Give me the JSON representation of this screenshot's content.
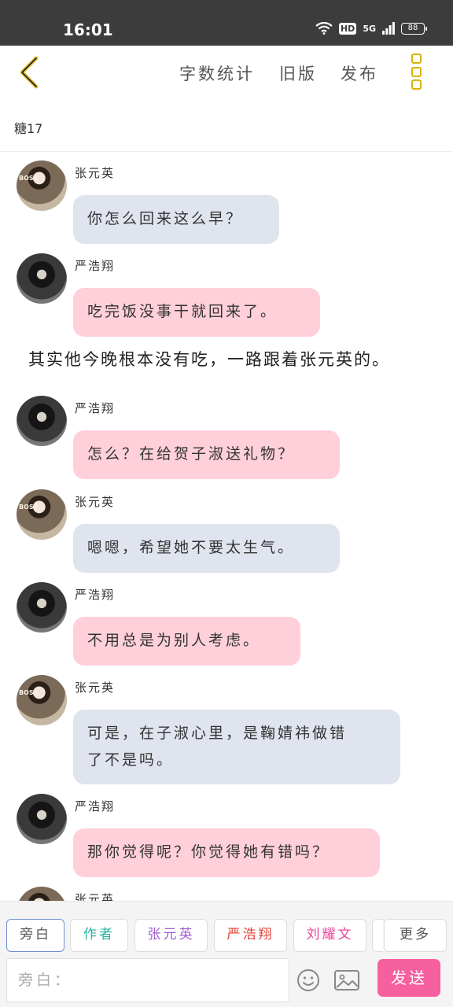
{
  "status": {
    "time": "16:01",
    "hd": "HD",
    "signal": "5G",
    "battery": "88"
  },
  "nav": {
    "word_count": "字数统计",
    "old_version": "旧版",
    "publish": "发布"
  },
  "story": {
    "title": "糖17"
  },
  "messages": [
    {
      "sender": "张元英",
      "text": "你怎么回来这么早？"
    },
    {
      "sender": "严浩翔",
      "text": "吃完饭没事干就回来了。"
    },
    {
      "narration": "其实他今晚根本没有吃，一路跟着张元英的。"
    },
    {
      "sender": "严浩翔",
      "text": "怎么？在给贺子淑送礼物？"
    },
    {
      "sender": "张元英",
      "text": "嗯嗯，希望她不要太生气。"
    },
    {
      "sender": "严浩翔",
      "text": "不用总是为别人考虑。"
    },
    {
      "sender": "张元英",
      "text_line1": "可是，在子淑心里，是鞠婧祎做错",
      "text_line2": "了不是吗。"
    },
    {
      "sender": "严浩翔",
      "text": "那你觉得呢？你觉得她有错吗？"
    },
    {
      "sender": "张元英"
    }
  ],
  "avatar_deco": "BOSS",
  "roles": [
    "旁白",
    "作者",
    "张元英",
    "严浩翔",
    "刘耀文",
    "更多"
  ],
  "role_colors": [
    "#555555",
    "#2bb3a3",
    "#a25fd0",
    "#e0433a",
    "#e8459a",
    "#555555"
  ],
  "input": {
    "placeholder": "旁白："
  },
  "send_label": "发送",
  "colors": {
    "accent": "#d8b200",
    "send": "#f7609f",
    "bubble_gray": "#dfe4ee",
    "bubble_pink": "#ffd0da"
  }
}
